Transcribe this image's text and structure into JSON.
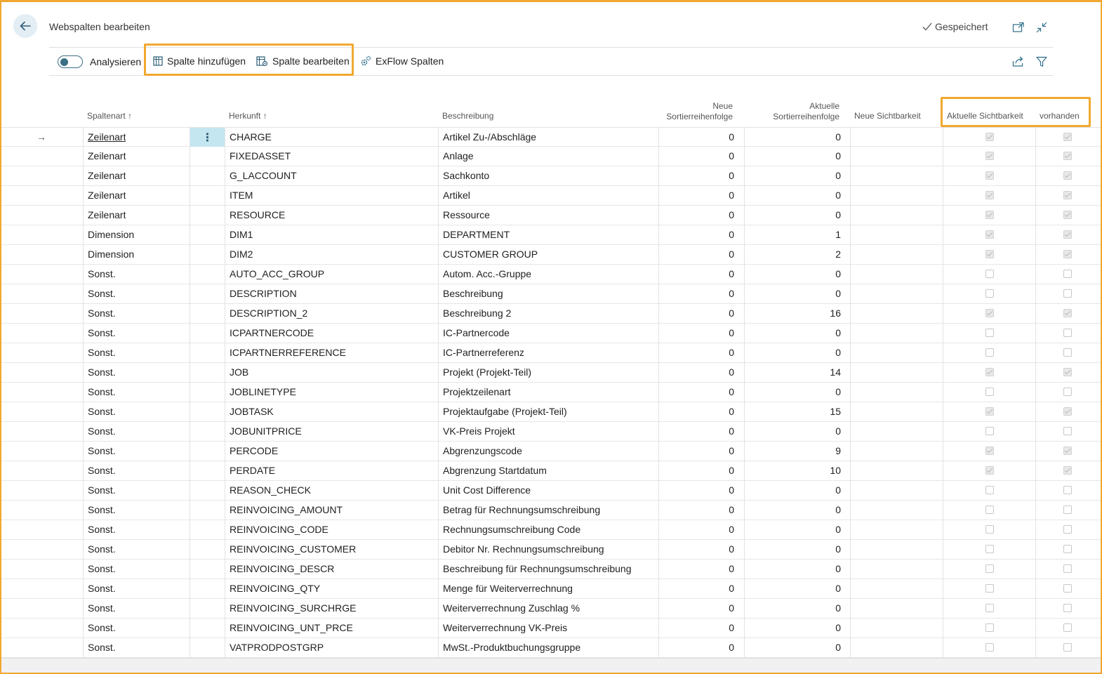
{
  "header": {
    "title": "Webspalten bearbeiten",
    "saved_label": "Gespeichert"
  },
  "toolbar": {
    "analyze_label": "Analysieren",
    "add_column_label": "Spalte hinzufügen",
    "edit_column_label": "Spalte bearbeiten",
    "exflow_columns_label": "ExFlow Spalten"
  },
  "columns": {
    "spaltenart": "Spaltenart",
    "herkunft": "Herkunft",
    "beschreibung": "Beschreibung",
    "neue_sort_1": "Neue",
    "neue_sort_2": "Sortierreihenfolge",
    "akt_sort_1": "Aktuelle",
    "akt_sort_2": "Sortierreihenfolge",
    "neue_sicht": "Neue Sichtbarkeit",
    "akt_sicht": "Aktuelle Sichtbarkeit",
    "vorhanden": "vorhanden"
  },
  "rows": [
    {
      "type": "Zeilenart",
      "source": "CHARGE",
      "desc": "Artikel Zu-/Abschläge",
      "new_sort": "0",
      "cur_sort": "0",
      "cur_vis": true,
      "exists": true
    },
    {
      "type": "Zeilenart",
      "source": "FIXEDASSET",
      "desc": "Anlage",
      "new_sort": "0",
      "cur_sort": "0",
      "cur_vis": true,
      "exists": true
    },
    {
      "type": "Zeilenart",
      "source": "G_LACCOUNT",
      "desc": "Sachkonto",
      "new_sort": "0",
      "cur_sort": "0",
      "cur_vis": true,
      "exists": true
    },
    {
      "type": "Zeilenart",
      "source": "ITEM",
      "desc": "Artikel",
      "new_sort": "0",
      "cur_sort": "0",
      "cur_vis": true,
      "exists": true
    },
    {
      "type": "Zeilenart",
      "source": "RESOURCE",
      "desc": "Ressource",
      "new_sort": "0",
      "cur_sort": "0",
      "cur_vis": true,
      "exists": true
    },
    {
      "type": "Dimension",
      "source": "DIM1",
      "desc": "DEPARTMENT",
      "new_sort": "0",
      "cur_sort": "1",
      "cur_vis": true,
      "exists": true
    },
    {
      "type": "Dimension",
      "source": "DIM2",
      "desc": "CUSTOMER GROUP",
      "new_sort": "0",
      "cur_sort": "2",
      "cur_vis": true,
      "exists": true
    },
    {
      "type": "Sonst.",
      "source": "AUTO_ACC_GROUP",
      "desc": "Autom. Acc.-Gruppe",
      "new_sort": "0",
      "cur_sort": "0",
      "cur_vis": false,
      "exists": false
    },
    {
      "type": "Sonst.",
      "source": "DESCRIPTION",
      "desc": "Beschreibung",
      "new_sort": "0",
      "cur_sort": "0",
      "cur_vis": false,
      "exists": false
    },
    {
      "type": "Sonst.",
      "source": "DESCRIPTION_2",
      "desc": "Beschreibung 2",
      "new_sort": "0",
      "cur_sort": "16",
      "cur_vis": true,
      "exists": true
    },
    {
      "type": "Sonst.",
      "source": "ICPARTNERCODE",
      "desc": "IC-Partnercode",
      "new_sort": "0",
      "cur_sort": "0",
      "cur_vis": false,
      "exists": false
    },
    {
      "type": "Sonst.",
      "source": "ICPARTNERREFERENCE",
      "desc": "IC-Partnerreferenz",
      "new_sort": "0",
      "cur_sort": "0",
      "cur_vis": false,
      "exists": false
    },
    {
      "type": "Sonst.",
      "source": "JOB",
      "desc": "Projekt (Projekt-Teil)",
      "new_sort": "0",
      "cur_sort": "14",
      "cur_vis": true,
      "exists": true
    },
    {
      "type": "Sonst.",
      "source": "JOBLINETYPE",
      "desc": "Projektzeilenart",
      "new_sort": "0",
      "cur_sort": "0",
      "cur_vis": false,
      "exists": false
    },
    {
      "type": "Sonst.",
      "source": "JOBTASK",
      "desc": "Projektaufgabe (Projekt-Teil)",
      "new_sort": "0",
      "cur_sort": "15",
      "cur_vis": true,
      "exists": true
    },
    {
      "type": "Sonst.",
      "source": "JOBUNITPRICE",
      "desc": "VK-Preis Projekt",
      "new_sort": "0",
      "cur_sort": "0",
      "cur_vis": false,
      "exists": false
    },
    {
      "type": "Sonst.",
      "source": "PERCODE",
      "desc": "Abgrenzungscode",
      "new_sort": "0",
      "cur_sort": "9",
      "cur_vis": true,
      "exists": true
    },
    {
      "type": "Sonst.",
      "source": "PERDATE",
      "desc": "Abgrenzung Startdatum",
      "new_sort": "0",
      "cur_sort": "10",
      "cur_vis": true,
      "exists": true
    },
    {
      "type": "Sonst.",
      "source": "REASON_CHECK",
      "desc": "Unit Cost Difference",
      "new_sort": "0",
      "cur_sort": "0",
      "cur_vis": false,
      "exists": false
    },
    {
      "type": "Sonst.",
      "source": "REINVOICING_AMOUNT",
      "desc": "Betrag für Rechnungsumschreibung",
      "new_sort": "0",
      "cur_sort": "0",
      "cur_vis": false,
      "exists": false
    },
    {
      "type": "Sonst.",
      "source": "REINVOICING_CODE",
      "desc": "Rechnungsumschreibung Code",
      "new_sort": "0",
      "cur_sort": "0",
      "cur_vis": false,
      "exists": false
    },
    {
      "type": "Sonst.",
      "source": "REINVOICING_CUSTOMER",
      "desc": "Debitor Nr. Rechnungsumschreibung",
      "new_sort": "0",
      "cur_sort": "0",
      "cur_vis": false,
      "exists": false
    },
    {
      "type": "Sonst.",
      "source": "REINVOICING_DESCR",
      "desc": "Beschreibung für Rechnungsumschreibung",
      "new_sort": "0",
      "cur_sort": "0",
      "cur_vis": false,
      "exists": false
    },
    {
      "type": "Sonst.",
      "source": "REINVOICING_QTY",
      "desc": "Menge für Weiterverrechnung",
      "new_sort": "0",
      "cur_sort": "0",
      "cur_vis": false,
      "exists": false
    },
    {
      "type": "Sonst.",
      "source": "REINVOICING_SURCHRGE",
      "desc": "Weiterverrechnung Zuschlag %",
      "new_sort": "0",
      "cur_sort": "0",
      "cur_vis": false,
      "exists": false
    },
    {
      "type": "Sonst.",
      "source": "REINVOICING_UNT_PRCE",
      "desc": "Weiterverrechnung VK-Preis",
      "new_sort": "0",
      "cur_sort": "0",
      "cur_vis": false,
      "exists": false
    },
    {
      "type": "Sonst.",
      "source": "VATPRODPOSTGRP",
      "desc": "MwSt.-Produktbuchungsgruppe",
      "new_sort": "0",
      "cur_sort": "0",
      "cur_vis": false,
      "exists": false
    }
  ],
  "colors": {
    "accent": "#3b6f86",
    "highlight": "#f0a830",
    "selected_cell": "#c4e6f0"
  }
}
